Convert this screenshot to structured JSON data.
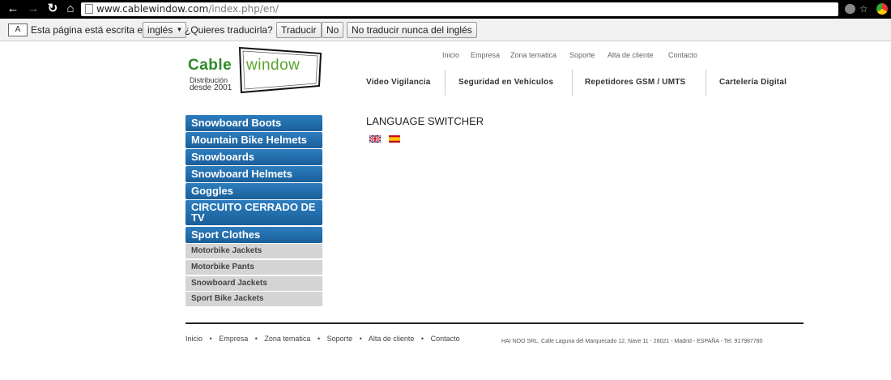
{
  "browser": {
    "url_host": "www.cablewindow.com",
    "url_path": "/index.php/en/"
  },
  "translate_bar": {
    "icon_text": "A",
    "message_prefix": "Esta página está escrita en",
    "language_select": "inglés",
    "question": "¿Quieres traducirla?",
    "translate_button": "Traducir",
    "no_button": "No",
    "never_button": "No traducir nunca del inglés"
  },
  "logo": {
    "cable": "Cable",
    "window": "window",
    "sub1": "Distribución",
    "sub2": "desde 2001"
  },
  "top_nav": [
    "Inicio",
    "Empresa",
    "Zona tematica",
    "Soporte",
    "Alta de cliente",
    "Contacto"
  ],
  "main_nav": [
    "Video Vigilancia",
    "Seguridad en Vehículos",
    "Repetidores GSM / UMTS",
    "Cartelería Digital"
  ],
  "sidebar": {
    "items": [
      "Snowboard Boots",
      "Mountain Bike Helmets",
      "Snowboards",
      "Snowboard Helmets",
      "Goggles",
      "CIRCUITO CERRADO DE TV",
      "Sport Clothes"
    ],
    "subitems": [
      "Motorbike Jackets",
      "Motorbike Pants",
      "Snowboard Jackets",
      "Sport Bike Jackets"
    ]
  },
  "content": {
    "title": "LANGUAGE SWITCHER"
  },
  "footer": {
    "links": [
      "Inicio",
      "Empresa",
      "Zona tematica",
      "Soporte",
      "Alta de cliente",
      "Contacto"
    ],
    "address": "HAI NOO SRL. Calle Laguna del Marquecado 12, Nave 11 - 28021 - Madrid - ESPAÑA - Tel. 917987780"
  }
}
